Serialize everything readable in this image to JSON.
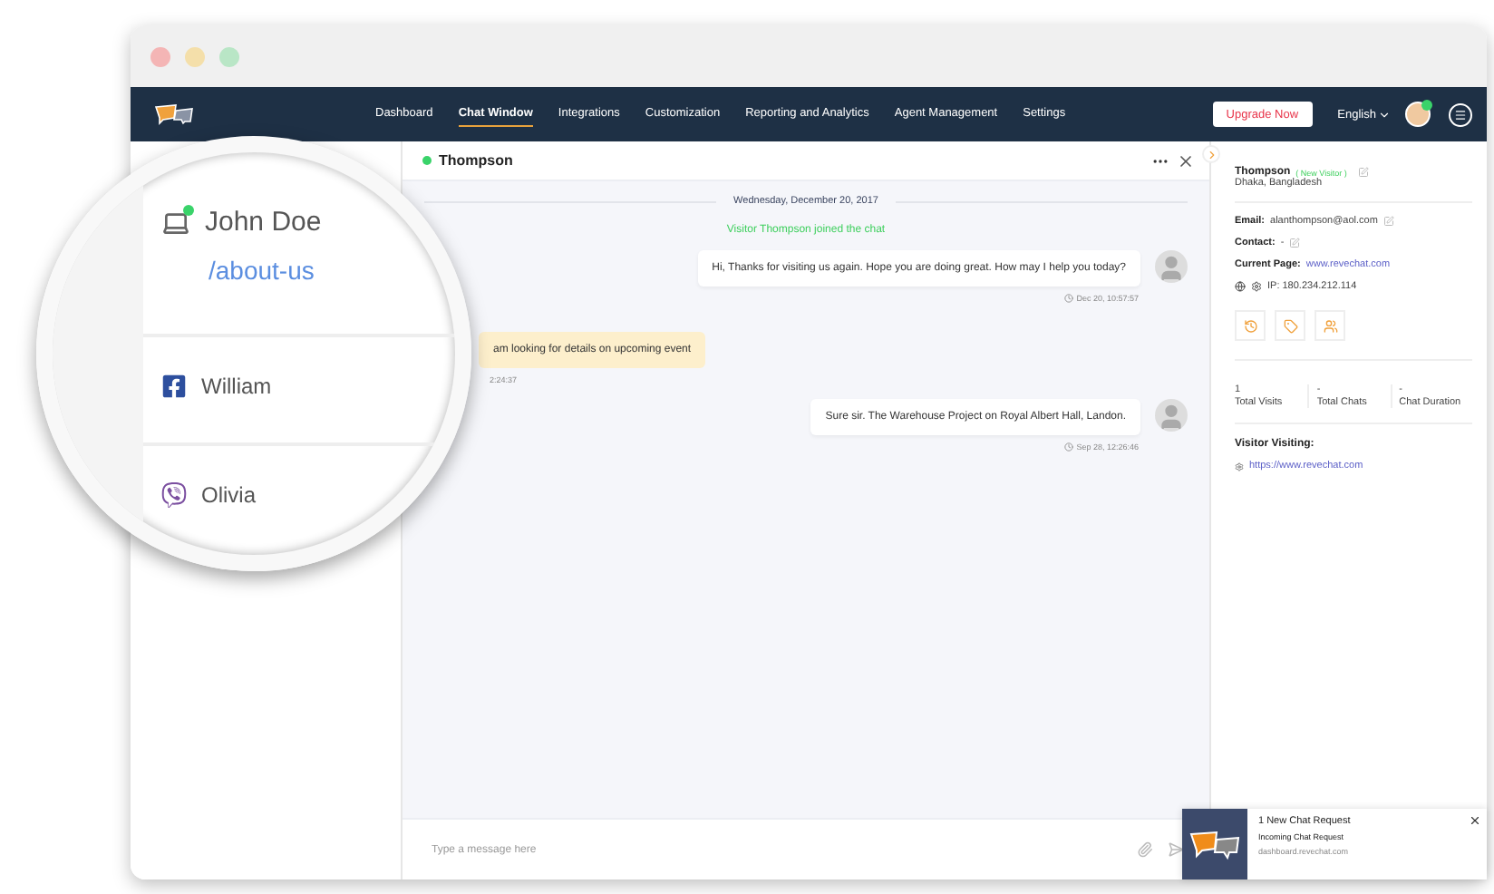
{
  "nav": {
    "items": [
      {
        "label": "Dashboard",
        "selected": false
      },
      {
        "label": "Chat Window",
        "selected": true
      },
      {
        "label": "Integrations",
        "selected": false
      },
      {
        "label": "Customization",
        "selected": false
      },
      {
        "label": "Reporting and Analytics",
        "selected": false
      },
      {
        "label": "Agent Management",
        "selected": false
      },
      {
        "label": "Settings",
        "selected": false
      }
    ],
    "upgrade_button": "Upgrade Now",
    "language": "English",
    "agent_online": true
  },
  "magnifier": {
    "items": [
      {
        "name": "John Doe",
        "kind": "web",
        "page": "/about-us",
        "online": true
      },
      {
        "name": "William",
        "kind": "facebook",
        "online": false
      },
      {
        "name": "Olivia",
        "kind": "viber",
        "online": false
      }
    ]
  },
  "chat": {
    "visitor": "Thompson",
    "online": true,
    "date": "Wednesday, December 20, 2017",
    "system_message": "Visitor Thompson joined the chat",
    "messages": [
      {
        "kind": "agent",
        "text": "Hi, Thanks for visiting us again. Hope you are doing great. How may I help you today?",
        "time": "Dec 20, 10:57:57"
      },
      {
        "kind": "visitor",
        "text": "am looking for details on upcoming event",
        "time": "2:24:37"
      },
      {
        "kind": "agent",
        "text": "Sure sir. The Warehouse Project on Royal Albert Hall, Landon.",
        "time": "Sep 28, 12:26:46"
      }
    ],
    "input_placeholder": "Type a message here"
  },
  "visitor_panel": {
    "name": "Thompson",
    "tag": "( New Visitor )",
    "location": "Dhaka, Bangladesh",
    "email_label": "Email:",
    "email": "alanthompson@aol.com",
    "contact_label": "Contact:",
    "contact": "-",
    "current_page_label": "Current Page:",
    "current_page": "www.revechat.com",
    "ip": "IP: 180.234.212.114",
    "stats": [
      {
        "value": "1",
        "label": "Total Visits"
      },
      {
        "value": "-",
        "label": "Total Chats"
      },
      {
        "value": "-",
        "label": "Chat Duration"
      }
    ],
    "visiting_title": "Visitor Visiting:",
    "visiting_url": "https://www.revechat.com"
  },
  "notification": {
    "title": "1 New Chat Request",
    "subtitle": "Incoming Chat Request",
    "source": "dashboard.revechat.com"
  }
}
